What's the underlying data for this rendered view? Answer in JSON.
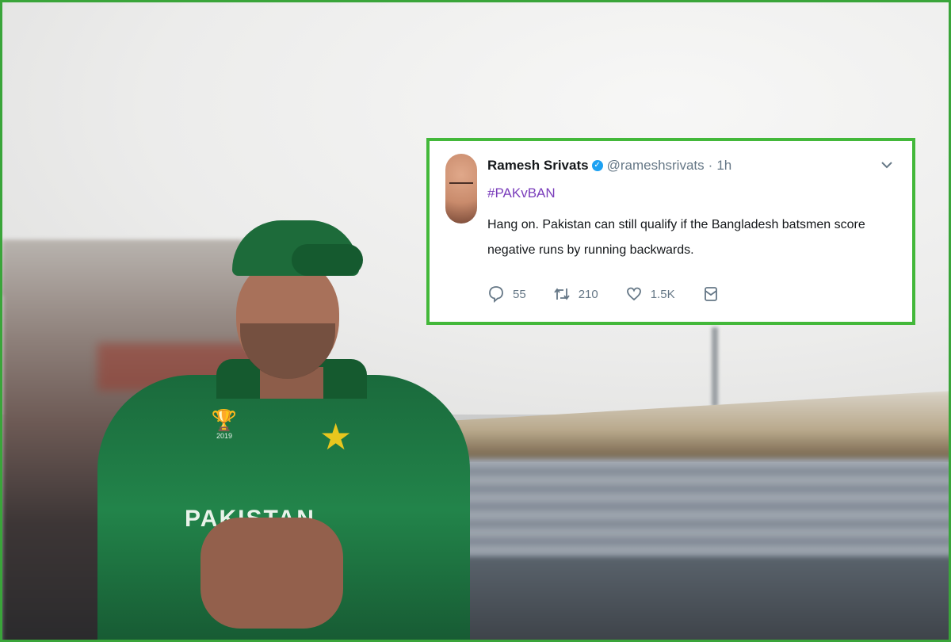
{
  "background": {
    "jersey_text": "PAKISTAN",
    "logo_text": "2019"
  },
  "tweet": {
    "author_name": "Ramesh Srivats",
    "handle": "@rameshsrivats",
    "separator": "·",
    "time": "1h",
    "hashtag": "#PAKvBAN",
    "text": "Hang on. Pakistan can still qualify if the Bangladesh batsmen score negative runs by running backwards.",
    "reply_count": "55",
    "retweet_count": "210",
    "like_count": "1.5K"
  },
  "colors": {
    "frame_border": "#3aa53a",
    "card_border": "#43b83a",
    "hashtag": "#7a3dbb",
    "verified": "#1da1f2",
    "meta_text": "#657786"
  },
  "icons": {
    "verified": "verified-badge-icon",
    "menu": "chevron-down-icon",
    "reply": "comment-icon",
    "retweet": "retweet-icon",
    "like": "heart-icon",
    "message": "mail-icon"
  }
}
